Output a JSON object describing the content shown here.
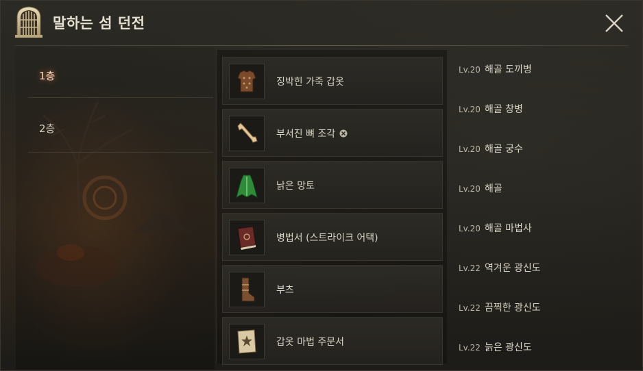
{
  "header": {
    "title": "말하는 섬 던전",
    "close_icon": "close-x-icon",
    "dungeon_icon": "dungeon-gate-icon"
  },
  "floors": [
    {
      "label": "1층",
      "active": true
    },
    {
      "label": "2층",
      "active": false
    }
  ],
  "items": [
    {
      "name": "징박힌 가죽 갑옷",
      "icon": "studded-leather-armor-icon",
      "bound": false
    },
    {
      "name": "부서진 뼈 조각",
      "icon": "broken-bone-fragment-icon",
      "bound": true
    },
    {
      "name": "낡은 망토",
      "icon": "old-cloak-icon",
      "bound": false
    },
    {
      "name": "병법서 (스트라이크 어택)",
      "icon": "tactics-book-icon",
      "bound": false
    },
    {
      "name": "부츠",
      "icon": "boots-icon",
      "bound": false
    },
    {
      "name": "갑옷 마법 주문서",
      "icon": "armor-scroll-icon",
      "bound": false
    }
  ],
  "monsters": [
    {
      "level": "Lv.20",
      "name": "해골 도끼병"
    },
    {
      "level": "Lv.20",
      "name": "해골 창병"
    },
    {
      "level": "Lv.20",
      "name": "해골 궁수"
    },
    {
      "level": "Lv.20",
      "name": "해골"
    },
    {
      "level": "Lv.20",
      "name": "해골 마법사"
    },
    {
      "level": "Lv.22",
      "name": "역겨운 광신도"
    },
    {
      "level": "Lv.22",
      "name": "끔찍한 광신도"
    },
    {
      "level": "Lv.22",
      "name": "늙은 광신도"
    }
  ]
}
